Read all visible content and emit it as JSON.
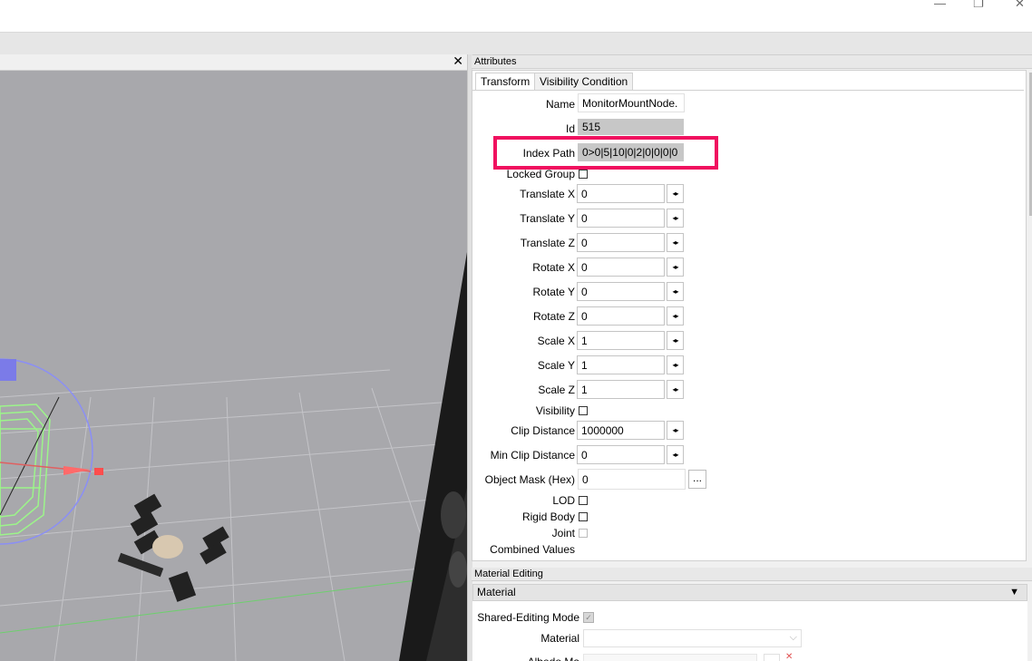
{
  "window": {
    "minimize_glyph": "—",
    "restore_glyph": "❐",
    "close_glyph": "✕"
  },
  "viewport": {
    "close_glyph": "✕"
  },
  "attributes": {
    "title": "Attributes",
    "tabs": [
      {
        "label": "Transform",
        "active": true
      },
      {
        "label": "Visibility Condition",
        "active": false
      }
    ],
    "name": {
      "label": "Name",
      "value": "MonitorMountNode."
    },
    "id": {
      "label": "Id",
      "value": "515"
    },
    "index_path": {
      "label": "Index Path",
      "value": "0>0|5|10|0|2|0|0|0|0"
    },
    "locked_group": {
      "label": "Locked Group"
    },
    "translate_x": {
      "label": "Translate X",
      "value": "0"
    },
    "translate_y": {
      "label": "Translate Y",
      "value": "0"
    },
    "translate_z": {
      "label": "Translate Z",
      "value": "0"
    },
    "rotate_x": {
      "label": "Rotate X",
      "value": "0"
    },
    "rotate_y": {
      "label": "Rotate Y",
      "value": "0"
    },
    "rotate_z": {
      "label": "Rotate Z",
      "value": "0"
    },
    "scale_x": {
      "label": "Scale X",
      "value": "1"
    },
    "scale_y": {
      "label": "Scale Y",
      "value": "1"
    },
    "scale_z": {
      "label": "Scale Z",
      "value": "1"
    },
    "visibility": {
      "label": "Visibility"
    },
    "clip_distance": {
      "label": "Clip Distance",
      "value": "1000000"
    },
    "min_clip_distance": {
      "label": "Min Clip Distance",
      "value": "0"
    },
    "object_mask": {
      "label": "Object Mask (Hex)",
      "value": "0",
      "button": "..."
    },
    "lod": {
      "label": "LOD"
    },
    "rigid_body": {
      "label": "Rigid Body"
    },
    "joint": {
      "label": "Joint"
    },
    "combined_values": {
      "label": "Combined Values"
    },
    "spin_glyph": "◂▸"
  },
  "material_editing": {
    "title": "Material Editing",
    "section": "Material",
    "collapse_glyph": "▼",
    "shared_editing_mode": {
      "label": "Shared-Editing Mode",
      "checked": true
    },
    "material": {
      "label": "Material",
      "value": ""
    },
    "albedo": {
      "label": "Albedo Ma"
    }
  },
  "colors": {
    "highlight": "#f0105f",
    "viewport_bg": "#a8a8ac",
    "wireframe": "#9cf58a"
  }
}
